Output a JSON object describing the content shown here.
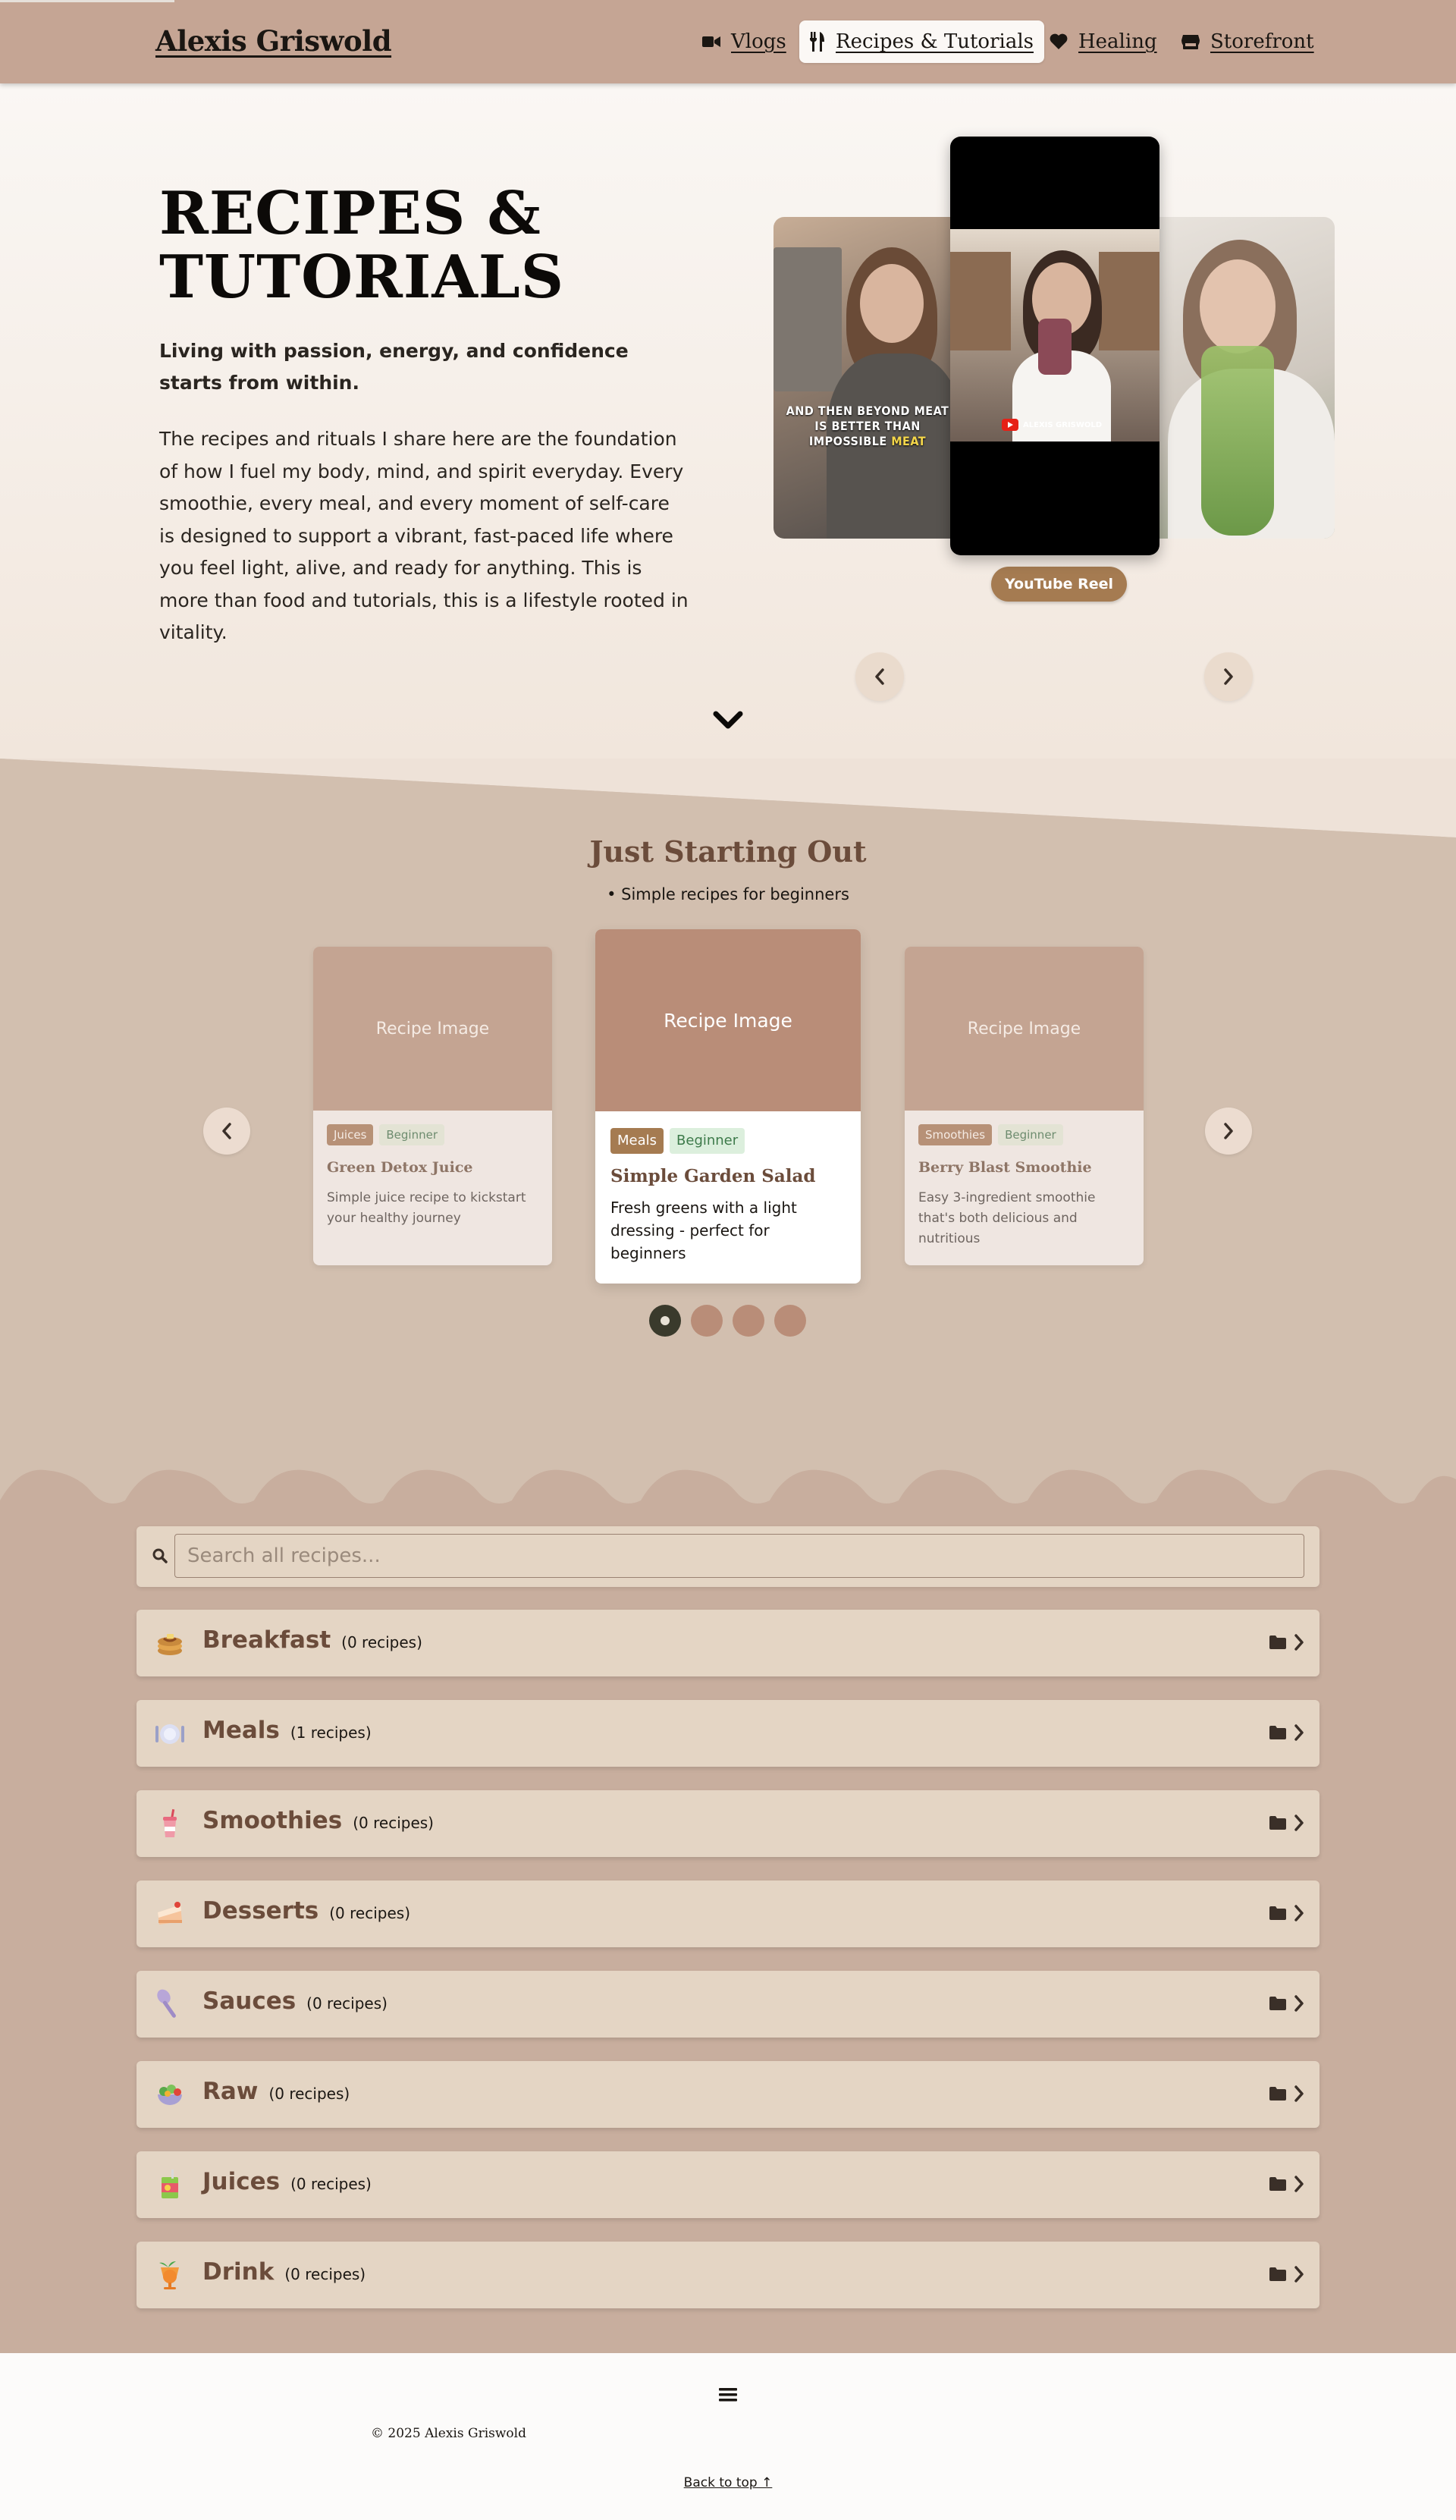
{
  "header": {
    "brand": "Alexis Griswold",
    "nav": [
      {
        "label": "Vlogs",
        "icon": "video-camera-icon"
      },
      {
        "label": "Recipes & Tutorials",
        "icon": "utensils-icon",
        "active": true
      },
      {
        "label": "Healing",
        "icon": "heart-icon"
      },
      {
        "label": "Storefront",
        "icon": "store-icon"
      }
    ]
  },
  "hero": {
    "title_line1": "RECIPES &",
    "title_line2": "TUTORIALS",
    "lead": "Living with passion, energy, and confidence starts from within.",
    "body": "The recipes and rituals I share here are the foundation of how I fuel my body, mind, and spirit everyday. Every smoothie, every meal, and every moment of self-care is designed to support a vibrant, fast-paced life where you feel light, alive, and ready for anything. This is more than food and tutorials, this is a lifestyle rooted in vitality.",
    "reel_caption_line1": "AND THEN BEYOND MEAT",
    "reel_caption_line2": "IS BETTER THAN",
    "reel_caption_line3a": "IMPOSSIBLE ",
    "reel_caption_line3b": "MEAT",
    "reel_watermark": "ALEXIS GRISWOLD",
    "reel_badge": "YouTube Reel"
  },
  "beginners": {
    "title": "Just Starting Out",
    "subtitle": "• Simple recipes for beginners",
    "cards": [
      {
        "image_label": "Recipe Image",
        "category": "Juices",
        "level": "Beginner",
        "name": "Green Detox Juice",
        "desc": "Simple juice recipe to kickstart your healthy journey"
      },
      {
        "image_label": "Recipe Image",
        "category": "Meals",
        "level": "Beginner",
        "name": "Simple Garden Salad",
        "desc": "Fresh greens with a light dressing - perfect for beginners"
      },
      {
        "image_label": "Recipe Image",
        "category": "Smoothies",
        "level": "Beginner",
        "name": "Berry Blast Smoothie",
        "desc": "Easy 3-ingredient smoothie that's both delicious and nutritious"
      }
    ],
    "dots": 4,
    "active_dot": 0
  },
  "search": {
    "placeholder": "Search all recipes..."
  },
  "categories": [
    {
      "name": "Breakfast",
      "count": "(0 recipes)",
      "icon": "pancakes-icon"
    },
    {
      "name": "Meals",
      "count": "(1 recipes)",
      "icon": "plate-icon"
    },
    {
      "name": "Smoothies",
      "count": "(0 recipes)",
      "icon": "cup-with-straw-icon"
    },
    {
      "name": "Desserts",
      "count": "(0 recipes)",
      "icon": "cake-icon"
    },
    {
      "name": "Sauces",
      "count": "(0 recipes)",
      "icon": "spoon-icon"
    },
    {
      "name": "Raw",
      "count": "(0 recipes)",
      "icon": "salad-icon"
    },
    {
      "name": "Juices",
      "count": "(0 recipes)",
      "icon": "juice-box-icon"
    },
    {
      "name": "Drink",
      "count": "(0 recipes)",
      "icon": "tropical-drink-icon"
    }
  ],
  "footer": {
    "copyright": "© 2025 Alexis Griswold",
    "back_to_top": "Back to top ↑"
  },
  "colors": {
    "header": "#c5a594",
    "accent": "#a57b51",
    "section": "#d2bfaf",
    "category_bg": "#c8ae9e",
    "row": "#e4d5c4",
    "heading_brown": "#6b4c3b"
  }
}
